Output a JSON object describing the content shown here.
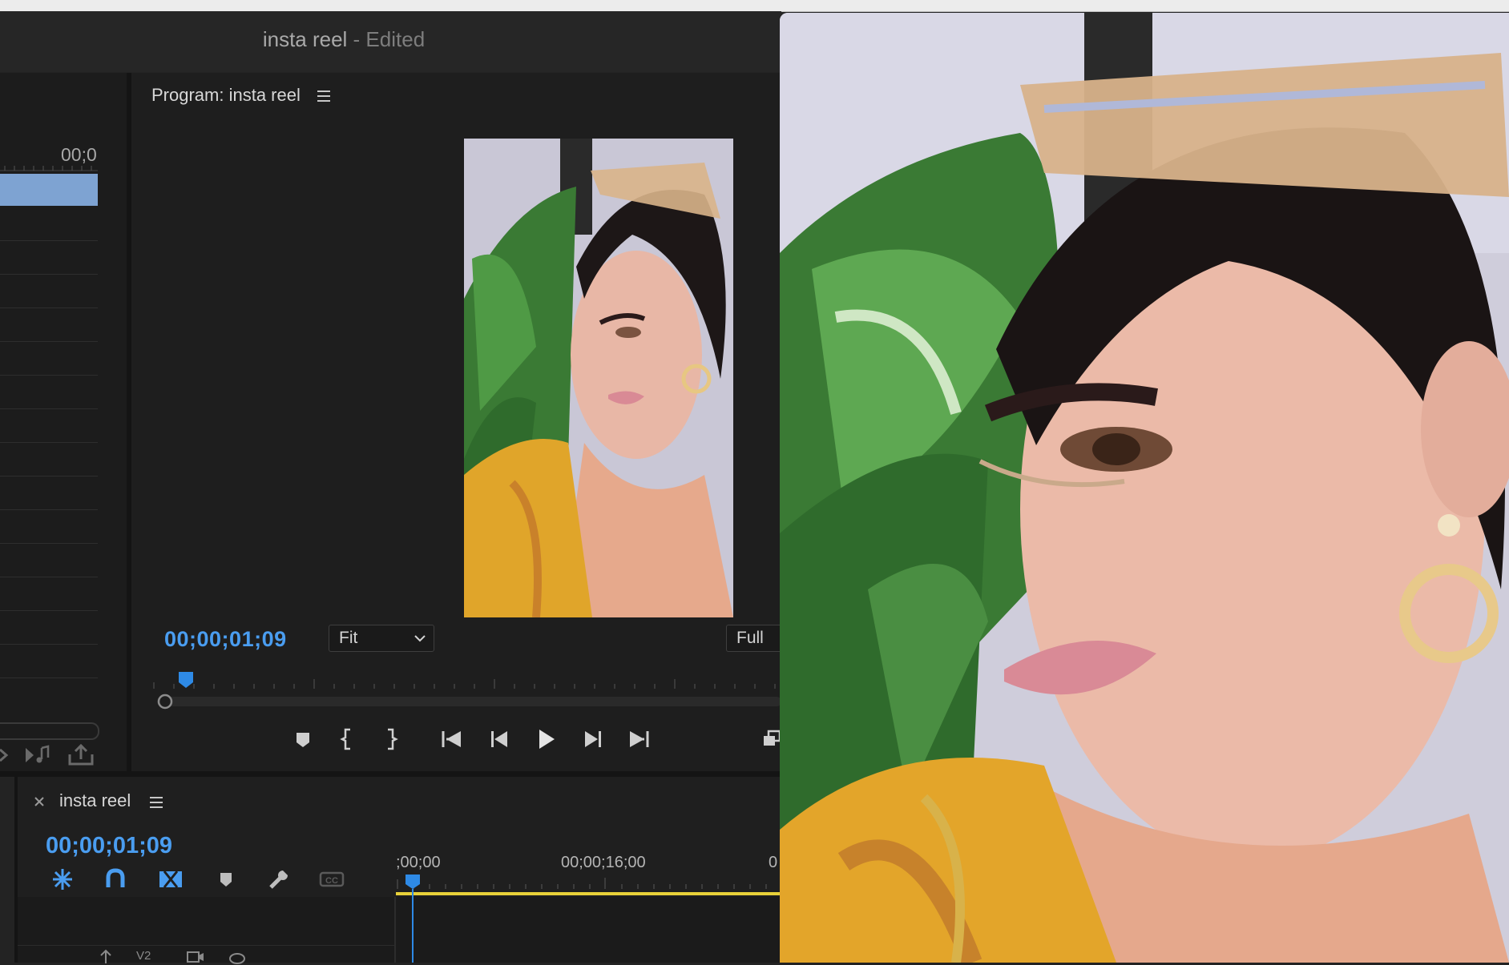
{
  "window": {
    "title": "insta reel",
    "suffix": " - Edited"
  },
  "source_panel": {
    "timecode": "00;0"
  },
  "program_monitor": {
    "title": "Program: insta reel",
    "timecode": "00;00;01;09",
    "fit_label": "Fit",
    "resolution_label": "Full"
  },
  "timeline": {
    "sequence_name": "insta reel",
    "timecode": "00;00;01;09",
    "ruler_labels": [
      ";00;00",
      "00;00;16;00",
      "0"
    ],
    "tools": [
      "snap-icon",
      "magnet-icon",
      "linked-selection-icon",
      "add-marker-icon",
      "wrench-icon",
      "captions-icon"
    ],
    "track_labels": [
      "V2"
    ]
  },
  "colors": {
    "accent_blue": "#4a9df0",
    "work_area_yellow": "#e8d13a",
    "clip_blue": "#7ea3d2"
  },
  "icons": {
    "menu": "hamburger-icon",
    "close": "close-icon",
    "chevron": "chevron-down-icon"
  }
}
